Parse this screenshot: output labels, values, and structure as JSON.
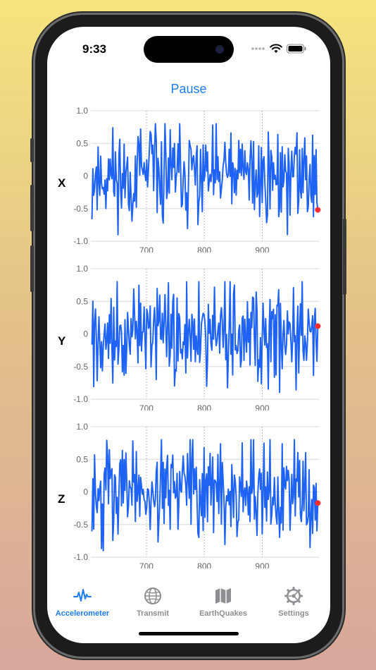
{
  "status": {
    "time": "9:33"
  },
  "header": {
    "pause_label": "Pause"
  },
  "charts": [
    {
      "axis": "X",
      "last_value": -0.52
    },
    {
      "axis": "Y",
      "last_value": 0.12
    },
    {
      "axis": "Z",
      "last_value": -0.17
    }
  ],
  "chart_data": [
    {
      "type": "line",
      "title": "",
      "series_label": "X",
      "xlim": [
        604,
        998
      ],
      "ylim": [
        -1.0,
        1.0
      ],
      "xticks": [
        700,
        800,
        900
      ],
      "yticks": [
        "1.0",
        "0.5",
        "0",
        "-0.5",
        "-1.0"
      ],
      "grid": true,
      "line_color": "#1f63f5",
      "marker_color": "#ff2d2d",
      "seed": 11,
      "last_value": -0.52
    },
    {
      "type": "line",
      "title": "",
      "series_label": "Y",
      "xlim": [
        604,
        998
      ],
      "ylim": [
        -1.0,
        1.0
      ],
      "xticks": [
        700,
        800,
        900
      ],
      "yticks": [
        "1.0",
        "0.5",
        "0",
        "-0.5",
        "-1.0"
      ],
      "grid": true,
      "line_color": "#1f63f5",
      "marker_color": "#ff2d2d",
      "seed": 27,
      "last_value": 0.12
    },
    {
      "type": "line",
      "title": "",
      "series_label": "Z",
      "xlim": [
        604,
        998
      ],
      "ylim": [
        -1.0,
        1.0
      ],
      "xticks": [
        700,
        800,
        900
      ],
      "yticks": [
        "1.0",
        "0.5",
        "0",
        "-0.5",
        "-1.0"
      ],
      "grid": true,
      "line_color": "#1f63f5",
      "marker_color": "#ff2d2d",
      "seed": 43,
      "last_value": -0.17
    }
  ],
  "tabs": [
    {
      "label": "Accelerometer",
      "icon": "waveform-icon",
      "active": true
    },
    {
      "label": "Transmit",
      "icon": "globe-icon",
      "active": false
    },
    {
      "label": "EarthQuakes",
      "icon": "map-icon",
      "active": false
    },
    {
      "label": "Settings",
      "icon": "gear-icon",
      "active": false
    }
  ],
  "colors": {
    "accent": "#1f7cf5",
    "inactive": "#8e8e93",
    "line": "#1f63f5",
    "marker": "#ff2d2d"
  }
}
